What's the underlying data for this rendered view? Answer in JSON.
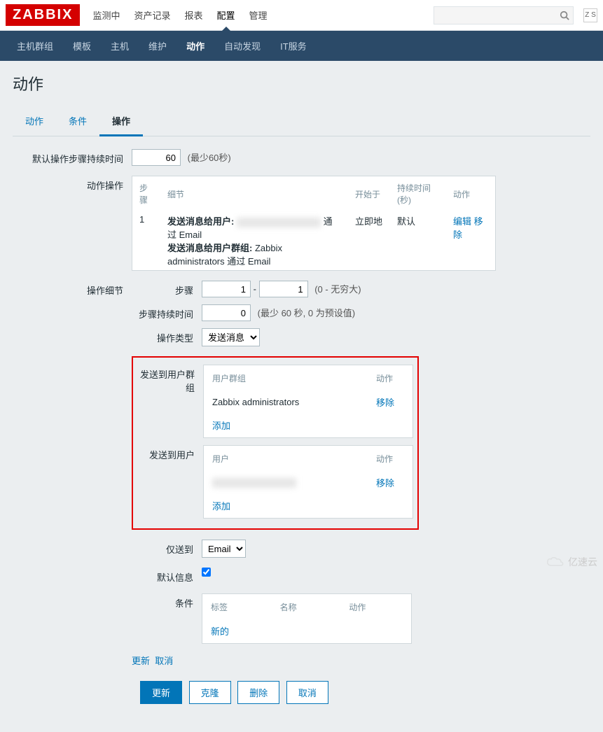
{
  "logo": "ZABBIX",
  "topnav": [
    "监测中",
    "资产记录",
    "报表",
    "配置",
    "管理"
  ],
  "topnav_active": 3,
  "share_badge": "Z S",
  "subnav": [
    "主机群组",
    "模板",
    "主机",
    "维护",
    "动作",
    "自动发现",
    "IT服务"
  ],
  "subnav_active": 4,
  "page_title": "动作",
  "tabs": [
    "动作",
    "条件",
    "操作"
  ],
  "tabs_active": 2,
  "form": {
    "default_step_duration_label": "默认操作步骤持续时间",
    "default_step_duration_value": "60",
    "default_step_duration_hint": "(最少60秒)",
    "action_operation_label": "动作操作",
    "op_cols": {
      "steps": "步骤",
      "details": "细节",
      "start": "开始于",
      "duration": "持续时间(秒)",
      "action": "动作"
    },
    "op_row": {
      "step": "1",
      "line1a": "发送消息给用户:",
      "line1b": "通过 Email",
      "line2": "发送消息给用户群组:",
      "line2b": "Zabbix administrators 通过 Email",
      "start": "立即地",
      "duration": "默认",
      "edit": "编辑",
      "remove": "移除"
    },
    "operation_details_label": "操作细节",
    "steps_label": "步骤",
    "steps_from": "1",
    "steps_to": "1",
    "steps_hint": "(0 - 无穷大)",
    "step_duration_label": "步骤持续时间",
    "step_duration_value": "0",
    "step_duration_hint": "(最少 60 秒, 0 为预设值)",
    "operation_type_label": "操作类型",
    "operation_type_value": "发送消息",
    "send_to_groups_label": "发送到用户群组",
    "groups_table": {
      "col1": "用户群组",
      "col2": "动作",
      "row1": "Zabbix administrators",
      "remove": "移除",
      "add": "添加"
    },
    "send_to_users_label": "发送到用户",
    "users_table": {
      "col1": "用户",
      "col2": "动作",
      "remove": "移除",
      "add": "添加"
    },
    "only_to_label": "仅送到",
    "only_to_value": "Email",
    "default_msg_label": "默认信息",
    "conditions_label": "条件",
    "cond_table": {
      "col1": "标签",
      "col2": "名称",
      "col3": "动作",
      "new": "新的"
    },
    "update_link": "更新",
    "cancel_link": "取消"
  },
  "buttons": {
    "update": "更新",
    "clone": "克隆",
    "delete": "删除",
    "cancel": "取消"
  },
  "watermark": "亿速云"
}
